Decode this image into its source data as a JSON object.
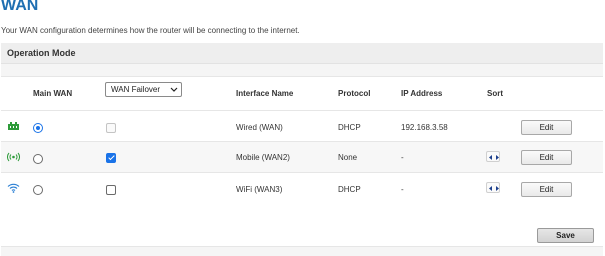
{
  "page": {
    "title": "WAN",
    "description": "Your WAN configuration determines how the router will be connecting to the internet."
  },
  "panel": {
    "title": "Operation Mode"
  },
  "table": {
    "headers": {
      "main_wan": "Main WAN",
      "interface_name": "Interface Name",
      "protocol": "Protocol",
      "ip_address": "IP Address",
      "sort": "Sort"
    },
    "mode_select": {
      "selected": "WAN Failover"
    },
    "rows": [
      {
        "icon": "ethernet-icon",
        "main_wan_selected": true,
        "failover_checked": false,
        "failover_disabled": true,
        "interface_name": "Wired (WAN)",
        "protocol": "DHCP",
        "ip_address": "192.168.3.58",
        "sortable": false,
        "edit_label": "Edit"
      },
      {
        "icon": "mobile-signal-icon",
        "main_wan_selected": false,
        "failover_checked": true,
        "failover_disabled": false,
        "interface_name": "Mobile (WAN2)",
        "protocol": "None",
        "ip_address": "-",
        "sortable": true,
        "edit_label": "Edit"
      },
      {
        "icon": "wifi-icon",
        "main_wan_selected": false,
        "failover_checked": false,
        "failover_disabled": false,
        "interface_name": "WiFi (WAN3)",
        "protocol": "DHCP",
        "ip_address": "-",
        "sortable": true,
        "edit_label": "Edit"
      }
    ]
  },
  "actions": {
    "save_label": "Save"
  },
  "colors": {
    "title": "#1f6fb2",
    "accent": "#1a73e8",
    "icon_green": "#2e9b3a",
    "sort_arrow": "#1c3f8c"
  }
}
